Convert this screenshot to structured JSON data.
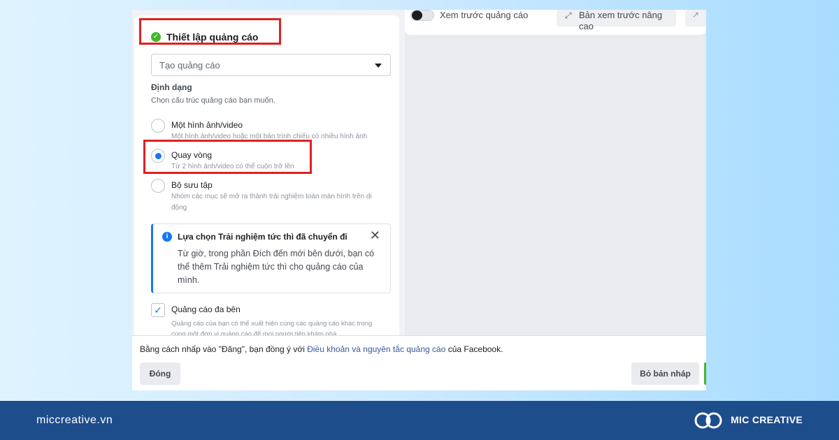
{
  "preview_bar": {
    "toggle_label": "Xem trước quảng cáo",
    "advanced_preview": "Bản xem trước nâng cao"
  },
  "ad_setup": {
    "title": "Thiết lập quảng cáo",
    "create_select": "Tạo quảng cáo",
    "format_label": "Định dạng",
    "format_desc": "Chọn cấu trúc quảng cáo bạn muốn.",
    "options": [
      {
        "title": "Một hình ảnh/video",
        "desc": "Một hình ảnh/video hoặc một bản trình chiếu có nhiều hình ảnh",
        "selected": false
      },
      {
        "title": "Quay vòng",
        "desc": "Từ 2 hình ảnh/video có thể cuộn trở lên",
        "selected": true
      },
      {
        "title": "Bộ sưu tập",
        "desc": "Nhóm các mục sẽ mở ra thành trải nghiệm toàn màn hình trên di động",
        "selected": false
      }
    ],
    "info_title": "Lựa chọn Trải nghiệm tức thì đã chuyển đi",
    "info_body": "Từ giờ, trong phần Đích đến mới bên dưới, bạn có thể thêm Trải nghiệm tức thì cho quảng cáo của mình.",
    "multi_ad_label": "Quảng cáo đa bên",
    "multi_ad_desc": "Quảng cáo của bạn có thể xuất hiện cùng các quảng cáo khác trong cùng một đơn vị quảng cáo để mọi người tiện khám phá"
  },
  "footer": {
    "terms_prefix": "Bằng cách nhấp vào \"Đăng\", bạn đồng ý với ",
    "terms_link": "Điều khoản và nguyên tắc quảng cáo",
    "terms_suffix": " của Facebook.",
    "close_button": "Đóng",
    "discard_button": "Bỏ bản nháp"
  },
  "branding": {
    "site": "miccreative.vn",
    "brand": "MIC CREATIVE"
  },
  "colors": {
    "accent": "#1877f2",
    "highlight": "#e02020",
    "success": "#42b72a",
    "bar": "#1e4d8c"
  }
}
